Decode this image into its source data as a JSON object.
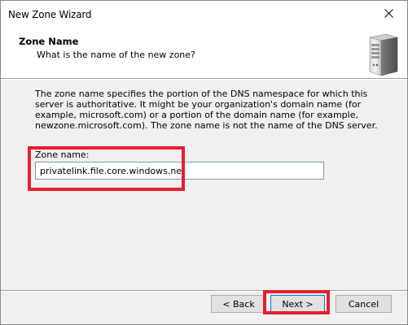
{
  "window": {
    "title": "New Zone Wizard"
  },
  "header": {
    "title": "Zone Name",
    "subtitle": "What is the name of the new zone?"
  },
  "content": {
    "description": "The zone name specifies the portion of the DNS namespace for which this server is authoritative. It might be your organization's domain name (for example, microsoft.com) or a portion of the domain name (for example, newzone.microsoft.com). The zone name is not the name of the DNS server.",
    "zone_name_label": "Zone name:",
    "zone_name_value": "privatelink.file.core.windows.net"
  },
  "footer": {
    "back_label": "< Back",
    "next_label": "Next >",
    "cancel_label": "Cancel"
  },
  "icons": {
    "close": "close-icon",
    "header": "server-icon"
  },
  "colors": {
    "highlight": "#e6202f",
    "content_bg": "#f0f0f0",
    "focus_border": "#0078d7"
  }
}
